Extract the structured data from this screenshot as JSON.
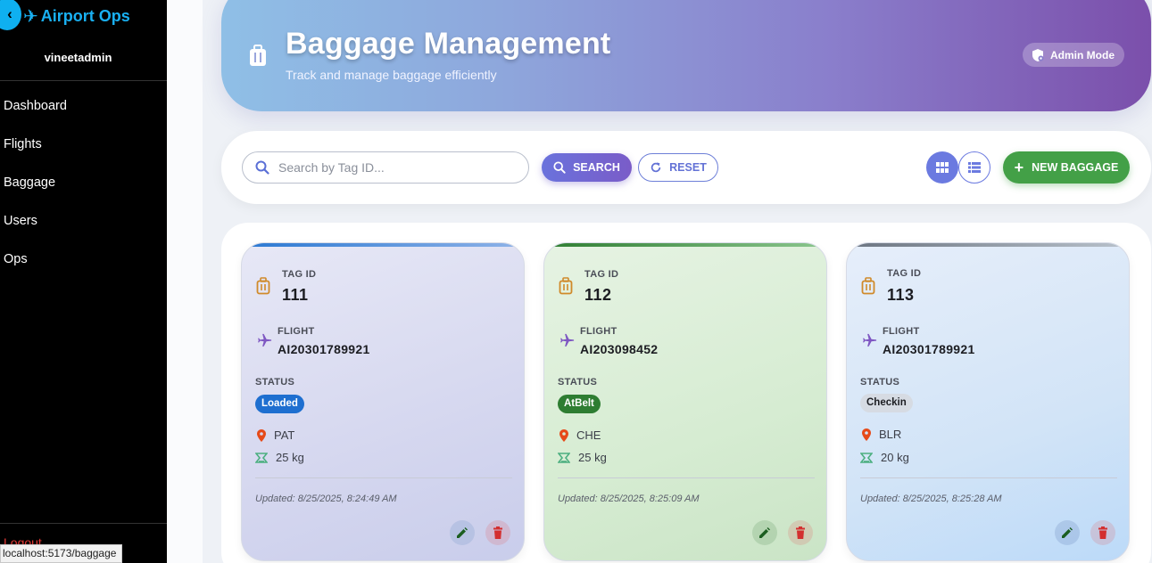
{
  "sidebar": {
    "brand": "Airport Ops",
    "collapse_icon": "chevron-left-icon",
    "username": "vineetadmin",
    "items": [
      {
        "label": "Dashboard"
      },
      {
        "label": "Flights"
      },
      {
        "label": "Baggage"
      },
      {
        "label": "Users"
      },
      {
        "label": "Ops"
      }
    ],
    "logout": "Logout"
  },
  "status_url": "localhost:5173/baggage",
  "header": {
    "title": "Baggage Management",
    "subtitle": "Track and manage baggage efficiently",
    "admin_badge": "Admin Mode"
  },
  "toolbar": {
    "search_placeholder": "Search by Tag ID...",
    "search_value": "",
    "search_label": "SEARCH",
    "reset_label": "RESET",
    "new_label": "NEW BAGGAGE",
    "view_mode": "grid"
  },
  "labels": {
    "tag_id": "TAG ID",
    "flight": "FLIGHT",
    "status": "STATUS"
  },
  "colors": {
    "accent": "#6b7ae0",
    "success": "#43a047",
    "loaded": "#1e6fd0",
    "atbelt": "#2e7d32",
    "checkin": "#d6dbe3"
  },
  "cards": [
    {
      "tag_id": "111",
      "flight": "AI20301789921",
      "status": "Loaded",
      "location": "PAT",
      "weight": "25 kg",
      "updated": "Updated: 8/25/2025, 8:24:49 AM"
    },
    {
      "tag_id": "112",
      "flight": "AI203098452",
      "status": "AtBelt",
      "location": "CHE",
      "weight": "25 kg",
      "updated": "Updated: 8/25/2025, 8:25:09 AM"
    },
    {
      "tag_id": "113",
      "flight": "AI20301789921",
      "status": "Checkin",
      "location": "BLR",
      "weight": "20 kg",
      "updated": "Updated: 8/25/2025, 8:25:28 AM"
    }
  ]
}
